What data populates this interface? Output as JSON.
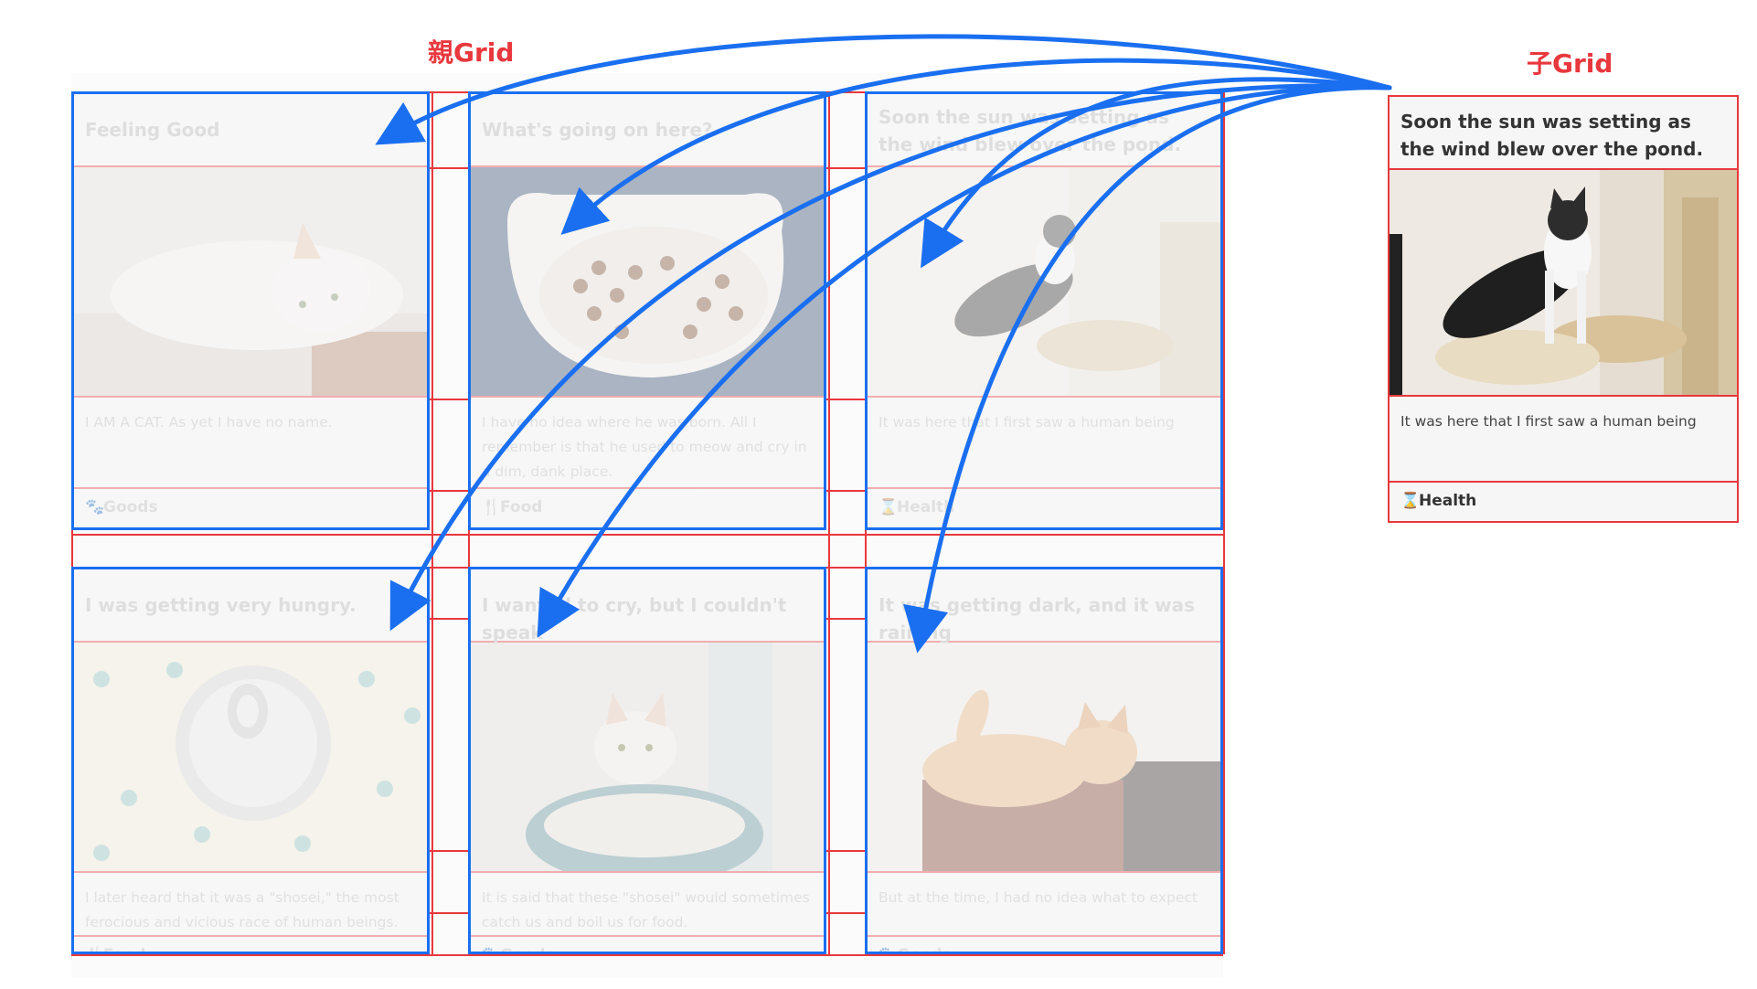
{
  "labels": {
    "parent_grid": "親Grid",
    "child_grid": "子Grid"
  },
  "colors": {
    "grid_line": "#e8383d",
    "card_border": "#1a6ff0",
    "label": "#e8383d"
  },
  "cards": [
    {
      "title": "Feeling Good",
      "text": "I AM A CAT. As yet I have no name.",
      "tag": "Goods",
      "tag_icon": "paw-icon",
      "image": "cat-lying-photo"
    },
    {
      "title": "What's going on here?",
      "text": "I have no idea where he was born. All I remember is that he used to meow and cry in a dim, dank place.",
      "tag": "Food",
      "tag_icon": "fork-knife-icon",
      "image": "cat-food-bowl-photo"
    },
    {
      "title": "Soon the sun was setting as the wind blew over the pond.",
      "text": "It was here that I first saw a human being",
      "tag": "Health",
      "tag_icon": "hourglass-icon",
      "image": "cat-standing-photo"
    },
    {
      "title": "I was getting very hungry.",
      "text": "I later heard that it was a \"shosei,\" the most ferocious and vicious race of human beings.",
      "tag": "Food",
      "tag_icon": "fork-knife-icon",
      "image": "cat-food-can-photo"
    },
    {
      "title": "I wanted to cry, but I couldn't speak",
      "text": "It is said that these \"shosei\" would sometimes catch us and boil us for food.",
      "tag": "Goods",
      "tag_icon": "paw-icon",
      "image": "cat-in-bag-photo"
    },
    {
      "title": "It was getting dark, and it was raining",
      "text": "But at the time, I had no idea what to expect",
      "tag": "Goods",
      "tag_icon": "paw-icon",
      "image": "cat-in-basket-photo"
    }
  ],
  "child_card": {
    "title": "Soon the sun was setting as the wind blew over the pond.",
    "text": "It was here that I first saw a human being",
    "tag": "Health",
    "tag_icon": "hourglass-icon",
    "image": "cat-standing-photo"
  }
}
